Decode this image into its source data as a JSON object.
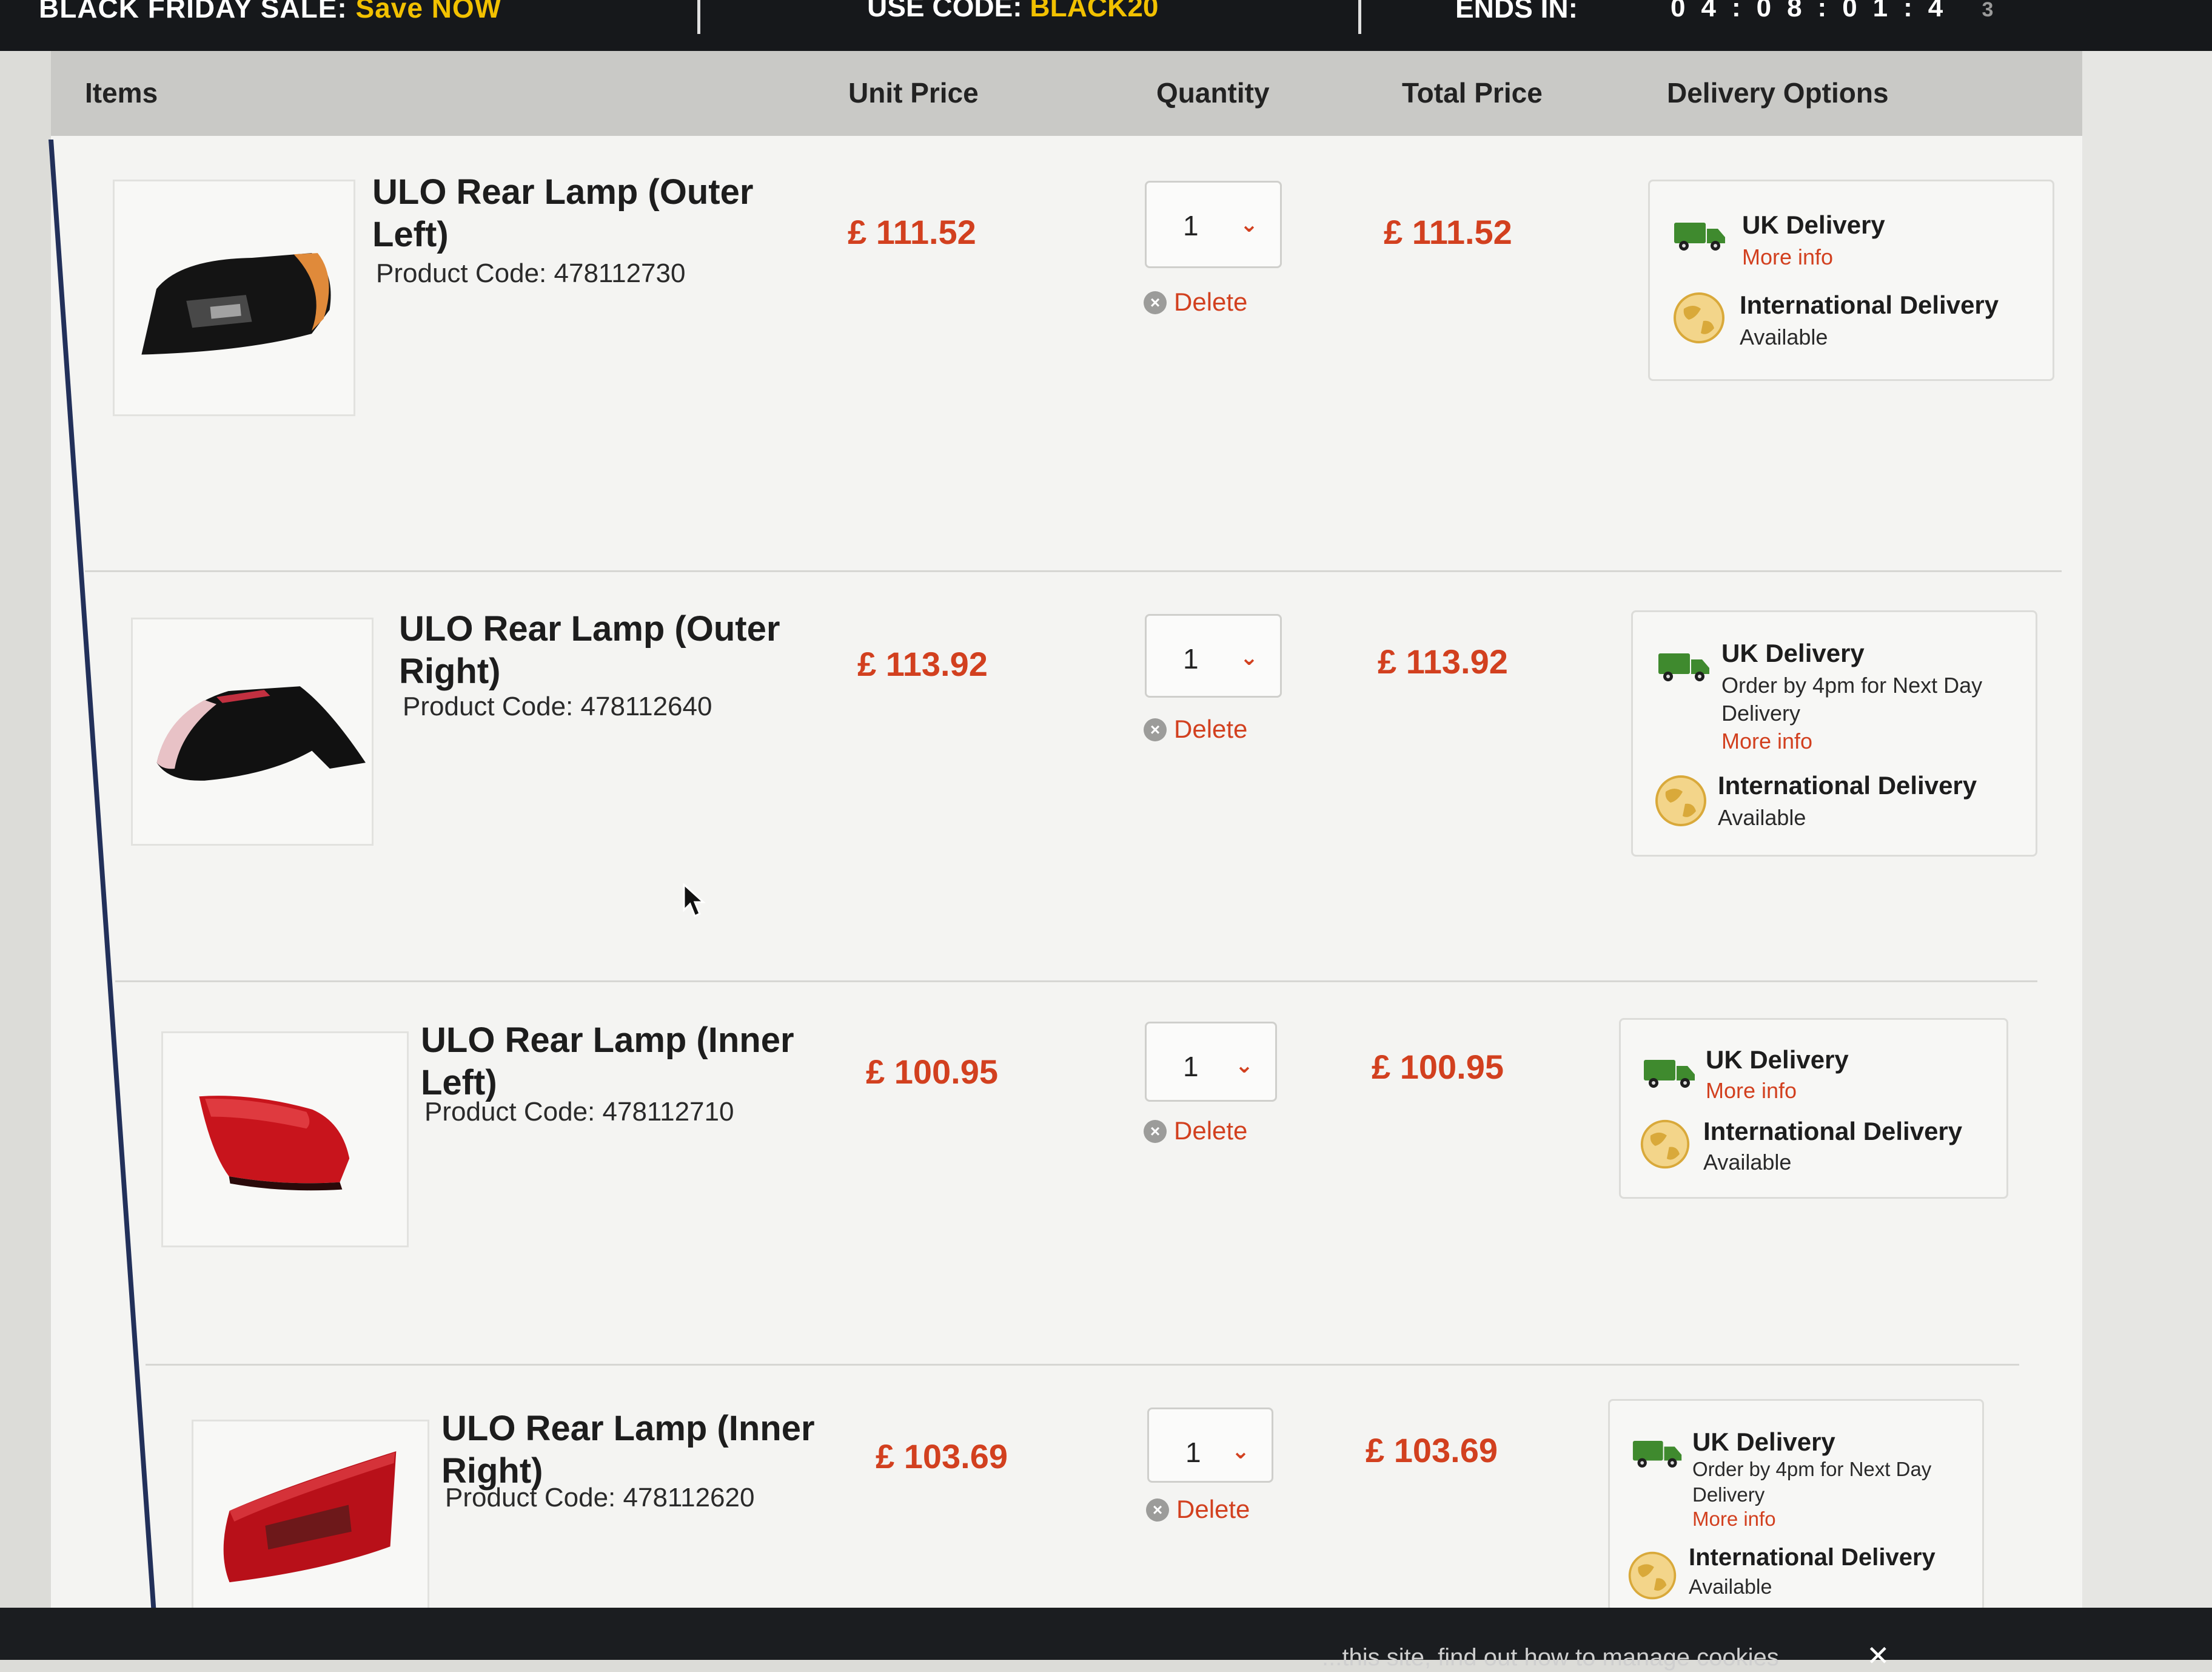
{
  "promo": {
    "sale_text": "BLACK FRIDAY SALE:",
    "sale_cta": "Save NOW",
    "code_label": "USE CODE:",
    "code_value": "BLACK20",
    "ends_label": "ENDS IN:",
    "timer": "04:08:01:4",
    "timer_tail": "3"
  },
  "header": {
    "items": "Items",
    "unit_price": "Unit Price",
    "quantity": "Quantity",
    "total_price": "Total Price",
    "delivery": "Delivery Options"
  },
  "colors": {
    "price_red": "#d2401f",
    "truck_green": "#3f8a2e",
    "promo_yellow": "#f2c100"
  },
  "items": [
    {
      "name": "ULO Rear Lamp (Outer Left)",
      "code": "Product Code: 478112730",
      "unit_price": "£ 111.52",
      "quantity": "1",
      "total_price": "£ 111.52",
      "delete": "Delete",
      "uk_title": "UK Delivery",
      "uk_note_1": "",
      "uk_note_2": "",
      "uk_link": "More info",
      "intl_title": "International Delivery",
      "intl_status": "Available",
      "image_icon": "outer-left-lamp"
    },
    {
      "name": "ULO Rear Lamp (Outer Right)",
      "code": "Product Code: 478112640",
      "unit_price": "£ 113.92",
      "quantity": "1",
      "total_price": "£ 113.92",
      "delete": "Delete",
      "uk_title": "UK Delivery",
      "uk_note_1": "Order by 4pm for Next Day",
      "uk_note_2": "Delivery",
      "uk_link": "More info",
      "intl_title": "International Delivery",
      "intl_status": "Available",
      "image_icon": "outer-right-lamp"
    },
    {
      "name": "ULO Rear Lamp (Inner Left)",
      "code": "Product Code: 478112710",
      "unit_price": "£ 100.95",
      "quantity": "1",
      "total_price": "£ 100.95",
      "delete": "Delete",
      "uk_title": "UK Delivery",
      "uk_note_1": "",
      "uk_note_2": "",
      "uk_link": "More info",
      "intl_title": "International Delivery",
      "intl_status": "Available",
      "image_icon": "inner-left-lamp"
    },
    {
      "name": "ULO Rear Lamp (Inner Right)",
      "code": "Product Code: 478112620",
      "unit_price": "£ 103.69",
      "quantity": "1",
      "total_price": "£ 103.69",
      "delete": "Delete",
      "uk_title": "UK Delivery",
      "uk_note_1": "Order by 4pm for Next Day",
      "uk_note_2": "Delivery",
      "uk_link": "More info",
      "intl_title": "International Delivery",
      "intl_status": "Available",
      "image_icon": "inner-right-lamp"
    }
  ],
  "cookie_bar": {
    "text": "...this site, find out how to manage cookies",
    "close": "✕"
  }
}
